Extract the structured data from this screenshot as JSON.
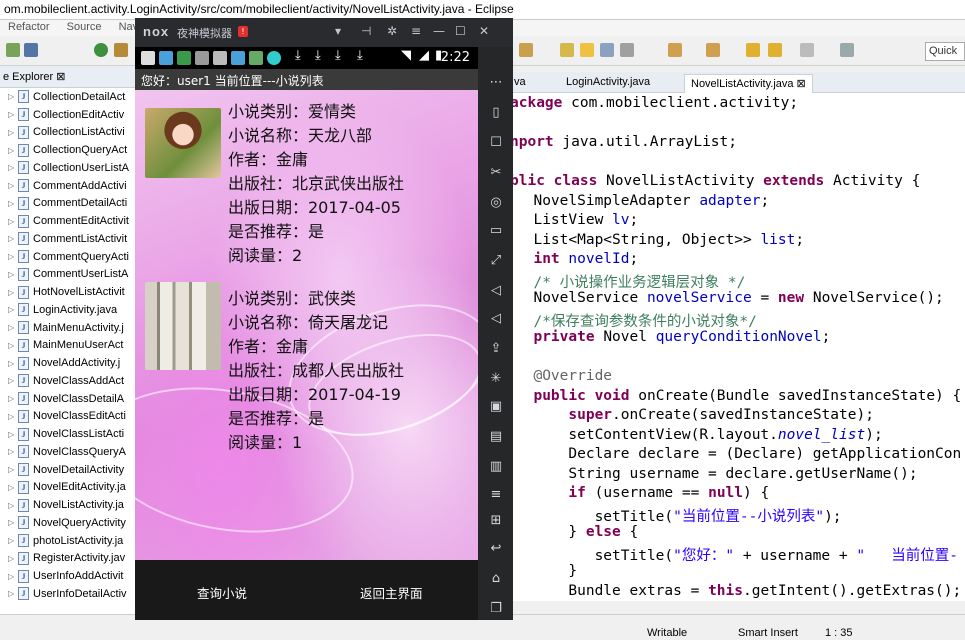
{
  "eclipse": {
    "title": "om.mobileclient.activity.LoginActivity/src/com/mobileclient/activity/NovelListActivity.java - Eclipse",
    "menu": [
      "Refactor",
      "Source",
      "Navi"
    ],
    "quick_access": "Quick",
    "explorer_tab": "e Explorer ⊠",
    "files": [
      {
        "name": "CollectionDetailAct"
      },
      {
        "name": "CollectionEditActiv"
      },
      {
        "name": "CollectionListActivi"
      },
      {
        "name": "CollectionQueryAct"
      },
      {
        "name": "CollectionUserListA"
      },
      {
        "name": "CommentAddActivi"
      },
      {
        "name": "CommentDetailActi"
      },
      {
        "name": "CommentEditActivit"
      },
      {
        "name": "CommentListActivit"
      },
      {
        "name": "CommentQueryActi"
      },
      {
        "name": "CommentUserListA"
      },
      {
        "name": "HotNovelListActivit"
      },
      {
        "name": "LoginActivity.java"
      },
      {
        "name": "MainMenuActivity.j"
      },
      {
        "name": "MainMenuUserAct"
      },
      {
        "name": "NovelAddActivity.j"
      },
      {
        "name": "NovelClassAddAct"
      },
      {
        "name": "NovelClassDetailA"
      },
      {
        "name": "NovelClassEditActi"
      },
      {
        "name": "NovelClassListActi"
      },
      {
        "name": "NovelClassQueryA"
      },
      {
        "name": "NovelDetailActivity"
      },
      {
        "name": "NovelEditActivity.ja"
      },
      {
        "name": "NovelListActivity.ja"
      },
      {
        "name": "NovelQueryActivity"
      },
      {
        "name": "photoListActivity.ja"
      },
      {
        "name": "RegisterActivity.jav"
      },
      {
        "name": "UserInfoAddActivit"
      },
      {
        "name": "UserInfoDetailActiv"
      }
    ],
    "editor_tabs": [
      "va",
      "LoginActivity.java",
      "NovelListActivity.java ⊠"
    ],
    "status": {
      "mode": "Writable",
      "insert": "Smart Insert",
      "position": "1 : 35"
    }
  },
  "nox": {
    "logo": "nox",
    "name": "夜神模拟器",
    "badge": "!",
    "clock": "2:22",
    "app_title": "您好：user1   当前位置---小说列表",
    "books": [
      {
        "category": "小说类别：爱情类",
        "title": "小说名称：天龙八部",
        "author": "作者：金庸",
        "publisher": "出版社：北京武侠出版社",
        "date": "出版日期：2017-04-05",
        "recommended": "是否推荐：是",
        "reads": "阅读量：2"
      },
      {
        "category": "小说类别：武侠类",
        "title": "小说名称：倚天屠龙记",
        "author": "作者：金庸",
        "publisher": "出版社：成都人民出版社",
        "date": "出版日期：2017-04-19",
        "recommended": "是否推荐：是",
        "reads": "阅读量：1"
      }
    ],
    "buttons": {
      "query": "查询小说",
      "home": "返回主界面"
    }
  },
  "code": [
    {
      "parts": [
        {
          "t": "ackage ",
          "c": "kw"
        },
        {
          "t": "com.mobileclient.activity;",
          "c": ""
        }
      ]
    },
    {
      "parts": [
        {
          "t": "",
          "c": ""
        }
      ]
    },
    {
      "parts": [
        {
          "t": "nport ",
          "c": "kw"
        },
        {
          "t": "java.util.ArrayList;",
          "c": ""
        }
      ]
    },
    {
      "parts": [
        {
          "t": "",
          "c": ""
        }
      ]
    },
    {
      "parts": [
        {
          "t": "blic class ",
          "c": "kw"
        },
        {
          "t": "NovelListActivity ",
          "c": ""
        },
        {
          "t": "extends ",
          "c": "kw"
        },
        {
          "t": "Activity {",
          "c": ""
        }
      ]
    },
    {
      "parts": [
        {
          "t": "  NovelSimpleAdapter ",
          "c": ""
        },
        {
          "t": "adapter",
          "c": "fld"
        },
        {
          "t": ";",
          "c": ""
        }
      ]
    },
    {
      "parts": [
        {
          "t": "  ListView ",
          "c": ""
        },
        {
          "t": "lv",
          "c": "fld"
        },
        {
          "t": ";",
          "c": ""
        }
      ]
    },
    {
      "parts": [
        {
          "t": "  List<Map<String, Object>> ",
          "c": ""
        },
        {
          "t": "list",
          "c": "fld"
        },
        {
          "t": ";",
          "c": ""
        }
      ]
    },
    {
      "parts": [
        {
          "t": "  ",
          "c": ""
        },
        {
          "t": "int ",
          "c": "kw"
        },
        {
          "t": "novelId",
          "c": "fld"
        },
        {
          "t": ";",
          "c": ""
        }
      ]
    },
    {
      "parts": [
        {
          "t": "  /* 小说操作业务逻辑层对象 */",
          "c": "cmt"
        }
      ]
    },
    {
      "parts": [
        {
          "t": "  NovelService ",
          "c": ""
        },
        {
          "t": "novelService",
          "c": "fld"
        },
        {
          "t": " = ",
          "c": ""
        },
        {
          "t": "new ",
          "c": "kw"
        },
        {
          "t": "NovelService();",
          "c": ""
        }
      ]
    },
    {
      "parts": [
        {
          "t": "  /*保存查询参数条件的小说对象*/",
          "c": "cmt"
        }
      ]
    },
    {
      "parts": [
        {
          "t": "  ",
          "c": ""
        },
        {
          "t": "private ",
          "c": "kw"
        },
        {
          "t": "Novel ",
          "c": ""
        },
        {
          "t": "queryConditionNovel",
          "c": "fld"
        },
        {
          "t": ";",
          "c": ""
        }
      ]
    },
    {
      "parts": [
        {
          "t": "",
          "c": ""
        }
      ]
    },
    {
      "parts": [
        {
          "t": "  @Override",
          "c": "ann"
        }
      ]
    },
    {
      "parts": [
        {
          "t": "  ",
          "c": ""
        },
        {
          "t": "public void ",
          "c": "kw"
        },
        {
          "t": "onCreate(Bundle savedInstanceState) {",
          "c": ""
        }
      ]
    },
    {
      "parts": [
        {
          "t": "      ",
          "c": ""
        },
        {
          "t": "super",
          "c": "kw"
        },
        {
          "t": ".onCreate(savedInstanceState);",
          "c": ""
        }
      ]
    },
    {
      "parts": [
        {
          "t": "      setContentView(R.layout.",
          "c": ""
        },
        {
          "t": "novel_list",
          "c": "fld ital"
        },
        {
          "t": ");",
          "c": ""
        }
      ]
    },
    {
      "parts": [
        {
          "t": "      Declare declare = (Declare) getApplicationCon",
          "c": ""
        }
      ]
    },
    {
      "parts": [
        {
          "t": "      String username = declare.getUserName();",
          "c": ""
        }
      ]
    },
    {
      "parts": [
        {
          "t": "      ",
          "c": ""
        },
        {
          "t": "if ",
          "c": "kw"
        },
        {
          "t": "(username == ",
          "c": ""
        },
        {
          "t": "null",
          "c": "kw"
        },
        {
          "t": ") {",
          "c": ""
        }
      ]
    },
    {
      "parts": [
        {
          "t": "         setTitle(",
          "c": ""
        },
        {
          "t": "\"当前位置--小说列表\"",
          "c": "str"
        },
        {
          "t": ");",
          "c": ""
        }
      ]
    },
    {
      "parts": [
        {
          "t": "      } ",
          "c": ""
        },
        {
          "t": "else ",
          "c": "kw"
        },
        {
          "t": "{",
          "c": ""
        }
      ]
    },
    {
      "parts": [
        {
          "t": "         setTitle(",
          "c": ""
        },
        {
          "t": "\"您好：\"",
          "c": "str"
        },
        {
          "t": " + username + ",
          "c": ""
        },
        {
          "t": "\"   当前位置-",
          "c": "str"
        }
      ]
    },
    {
      "parts": [
        {
          "t": "      }",
          "c": ""
        }
      ]
    },
    {
      "parts": [
        {
          "t": "      Bundle extras = ",
          "c": ""
        },
        {
          "t": "this",
          "c": "kw"
        },
        {
          "t": ".getIntent().getExtras();",
          "c": ""
        }
      ]
    }
  ]
}
